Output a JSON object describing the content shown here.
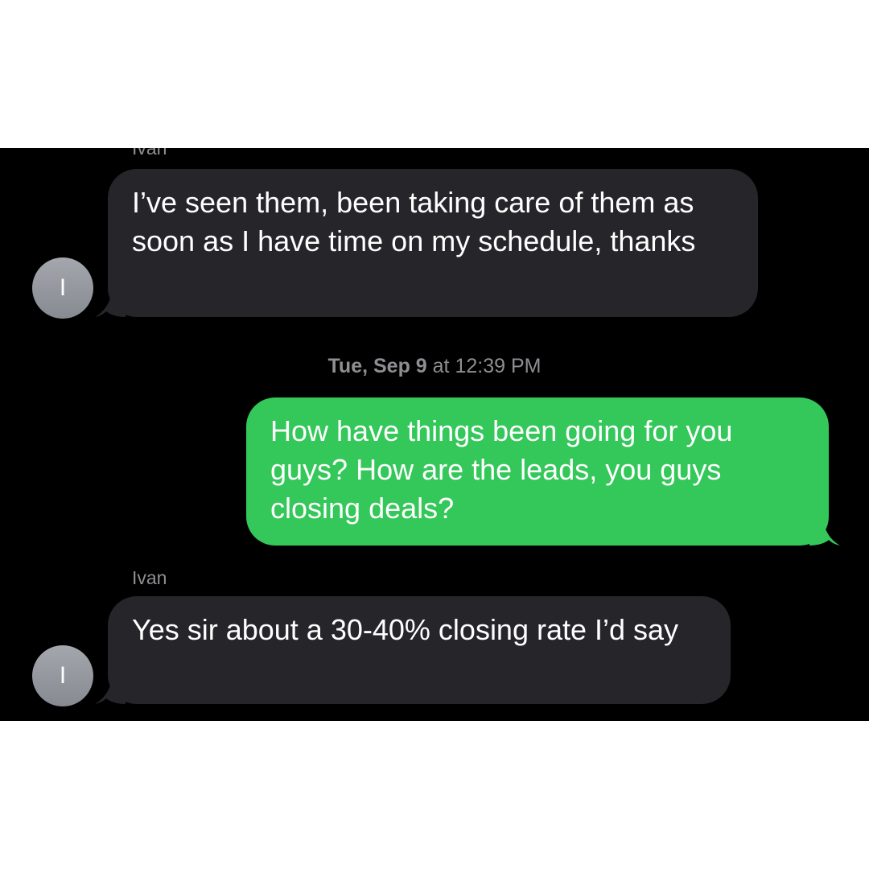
{
  "conversation": {
    "messages": [
      {
        "direction": "incoming",
        "sender": "Ivan",
        "avatar_initial": "I",
        "text": "I’ve seen them, been taking care of them as soon as I have time on my schedule, thanks"
      },
      {
        "direction": "outgoing",
        "text": "How have things been going for you guys? How are the leads, you guys closing deals?"
      },
      {
        "direction": "incoming",
        "sender": "Ivan",
        "avatar_initial": "I",
        "text": "Yes sir about a 30-40% closing rate I’d say"
      }
    ],
    "timestamp": {
      "day": "Tue, Sep 9",
      "time": "at 12:39 PM"
    }
  },
  "colors": {
    "background": "#000000",
    "incoming_bubble": "#26252a",
    "outgoing_bubble": "#34c759",
    "meta_text": "#8e8e93"
  }
}
